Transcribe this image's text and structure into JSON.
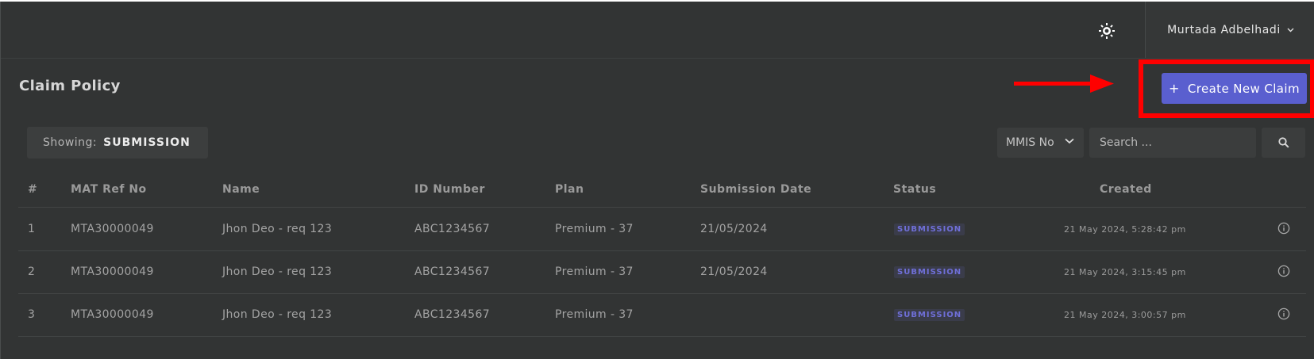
{
  "header": {
    "user_name": "Murtada Adbelhadi",
    "theme_icon": "sun-icon"
  },
  "page": {
    "title": "Claim Policy",
    "create_button_label": "Create New Claim",
    "create_button_icon": "+"
  },
  "filters": {
    "showing_label": "Showing:",
    "showing_value": "SUBMISSION",
    "field_select_value": "MMIS No",
    "search_placeholder": "Search ..."
  },
  "table": {
    "columns": [
      "#",
      "MAT Ref No",
      "Name",
      "ID Number",
      "Plan",
      "Submission Date",
      "Status",
      "Created"
    ],
    "rows": [
      {
        "num": "1",
        "mat_ref": "MTA30000049",
        "name": "Jhon Deo - req 123",
        "id_number": "ABC1234567",
        "plan": "Premium - 37",
        "submission_date": "21/05/2024",
        "status": "SUBMISSION",
        "created": "21 May 2024, 5:28:42 pm"
      },
      {
        "num": "2",
        "mat_ref": "MTA30000049",
        "name": "Jhon Deo - req 123",
        "id_number": "ABC1234567",
        "plan": "Premium - 37",
        "submission_date": "21/05/2024",
        "status": "SUBMISSION",
        "created": "21 May 2024, 3:15:45 pm"
      },
      {
        "num": "3",
        "mat_ref": "MTA30000049",
        "name": "Jhon Deo - req 123",
        "id_number": "ABC1234567",
        "plan": "Premium - 37",
        "submission_date": "",
        "status": "SUBMISSION",
        "created": "21 May 2024, 3:00:57 pm"
      }
    ]
  },
  "colors": {
    "background": "#323434",
    "accent": "#5a5fcf",
    "status_badge_text": "#6f6fd8",
    "highlight": "#ff0000"
  }
}
